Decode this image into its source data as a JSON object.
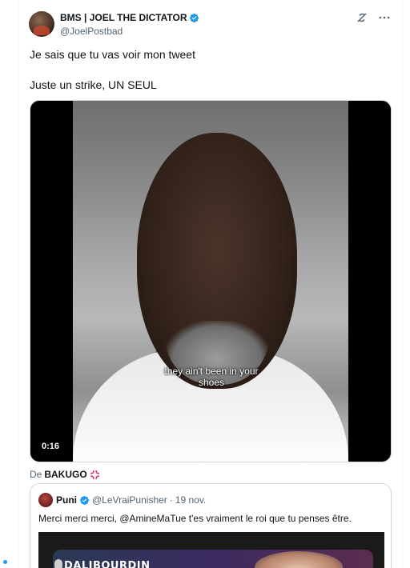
{
  "tweet": {
    "author": {
      "display_name": "BMS | JOEL THE DICTATOR",
      "handle": "@JoelPostbad",
      "verified": true
    },
    "text_lines": [
      "Je sais que tu vas voir mon tweet",
      "Juste un strike, UN SEUL"
    ],
    "video": {
      "caption_line1": "they ain't been in your",
      "caption_line2": "shoes",
      "duration": "0:16"
    },
    "attribution": {
      "prefix": "De",
      "source": "BAKUGO",
      "icon": "anger-icon"
    }
  },
  "quote": {
    "author": {
      "display_name": "Puni",
      "handle": "@LeVraiPunisher",
      "separator": "·",
      "date": "19 nov.",
      "verified": true
    },
    "text": "Merci merci merci, @AmineMaTue t'es vraiment le roi que tu penses être.",
    "media_label": "DALIBOURDIN"
  },
  "icons": {
    "grok": "grok-icon",
    "more": "more-icon",
    "verified": "verified-badge-icon"
  },
  "colors": {
    "verified_blue": "#1d9bf0",
    "text_primary": "#0f1419",
    "text_secondary": "#536471",
    "border": "#cfd9de"
  }
}
